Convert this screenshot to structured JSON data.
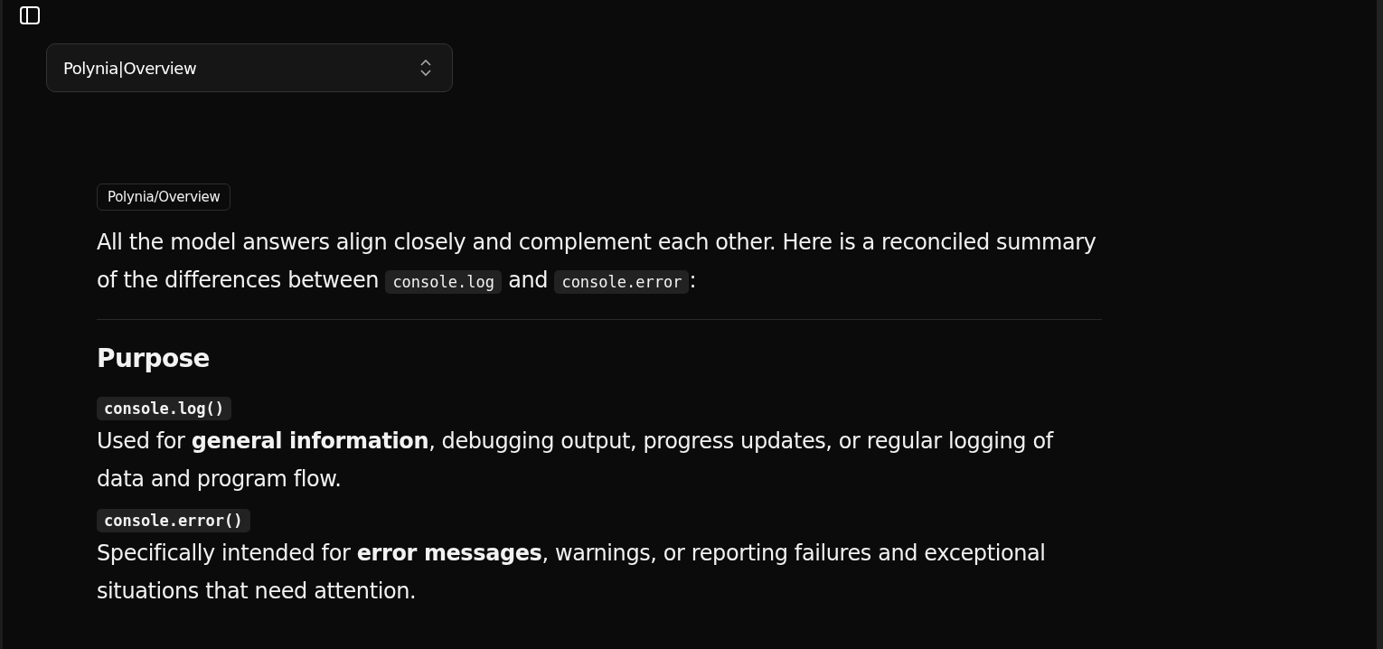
{
  "selector": {
    "label": "Polynia|Overview"
  },
  "source_tag": "Polynia/Overview",
  "intro": [
    {
      "kind": "text",
      "text": "All the model answers align closely and complement each other. Here is a reconciled summary of the differences between "
    },
    {
      "kind": "code",
      "text": "console.log"
    },
    {
      "kind": "text",
      "text": " and "
    },
    {
      "kind": "code",
      "text": "console.error"
    },
    {
      "kind": "text",
      "text": ":"
    }
  ],
  "section": {
    "heading": "Purpose",
    "items": [
      {
        "term": "console.log()",
        "description": "Used for **general information**, debugging output, progress updates, or regular logging of data and program flow."
      },
      {
        "term": "console.error()",
        "description": "Specifically intended for **error messages**, warnings, or reporting failures and exceptional situations that need attention."
      }
    ]
  }
}
